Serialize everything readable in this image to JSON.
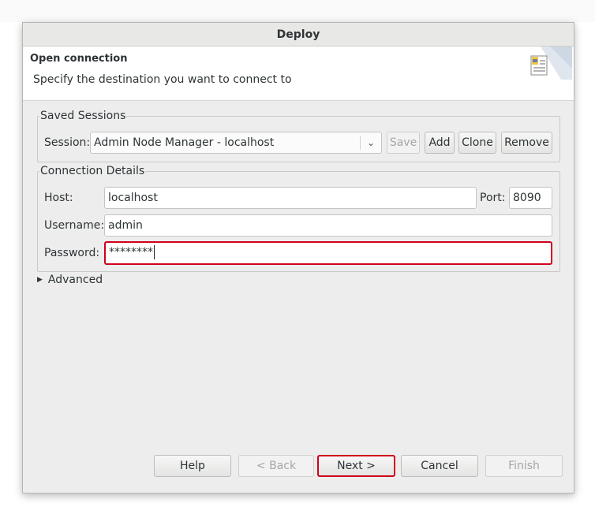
{
  "window": {
    "title": "Deploy"
  },
  "header": {
    "title": "Open connection",
    "description": "Specify the destination you want to connect to",
    "icon": "connection-wizard-icon"
  },
  "saved_sessions": {
    "legend": "Saved Sessions",
    "session_label": "Session:",
    "session_value": "Admin Node Manager - localhost",
    "buttons": {
      "save": "Save",
      "add": "Add",
      "clone": "Clone",
      "remove": "Remove"
    }
  },
  "connection": {
    "legend": "Connection Details",
    "host_label": "Host:",
    "host_value": "localhost",
    "port_label": "Port:",
    "port_value": "8090",
    "username_label": "Username:",
    "username_value": "admin",
    "password_label": "Password:",
    "password_value": "********"
  },
  "advanced": {
    "label": "Advanced"
  },
  "footer": {
    "help": "Help",
    "back": "< Back",
    "next": "Next >",
    "cancel": "Cancel",
    "finish": "Finish"
  },
  "colors": {
    "highlight": "#d0021b",
    "dialog_bg": "#ededed"
  }
}
